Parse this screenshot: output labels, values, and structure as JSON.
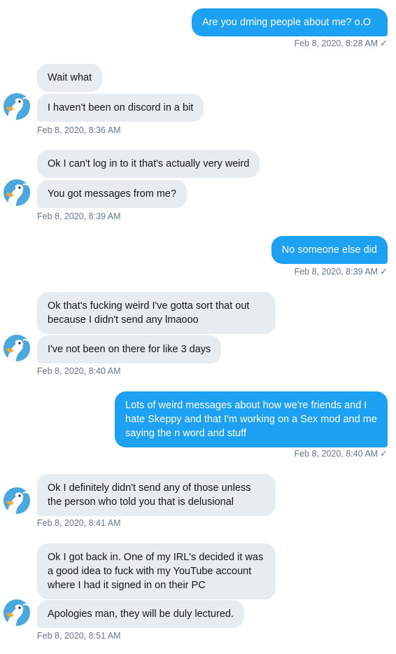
{
  "messages": [
    {
      "text": "Are you dming people about me? o.O"
    },
    {
      "text": "Wait what"
    },
    {
      "text": "I haven't been on discord in a bit"
    },
    {
      "text": "Ok I can't log in to it that's actually very weird"
    },
    {
      "text": "You got messages from me?"
    },
    {
      "text": "No someone else did"
    },
    {
      "text": "Ok that's fucking weird I've gotta sort that out because I didn't send any lmaooo"
    },
    {
      "text": "I've not been on there for like 3 days"
    },
    {
      "text": "Lots of weird messages about how we're friends and I hate Skeppy and that I'm working on a Sex mod and me saying the n word and stuff"
    },
    {
      "text": "Ok I definitely didn't send any of those unless the person who told you that is delusional"
    },
    {
      "text": "Ok I got back in.  One of my IRL's decided it was a good idea to fuck with my YouTube account where I had it signed in on their PC"
    },
    {
      "text": "Apologies man, they will be duly lectured."
    }
  ],
  "timestamps": [
    {
      "text": "Feb 8, 2020, 8:28 AM",
      "read_icon": "checkmark-icon"
    },
    {
      "text": "Feb 8, 2020, 8:36 AM"
    },
    {
      "text": "Feb 8, 2020, 8:39 AM"
    },
    {
      "text": "Feb 8, 2020, 8:39 AM",
      "read_icon": "checkmark-icon"
    },
    {
      "text": "Feb 8, 2020, 8:40 AM"
    },
    {
      "text": "Feb 8, 2020, 8:40 AM",
      "read_icon": "checkmark-icon"
    },
    {
      "text": "Feb 8, 2020, 8:41 AM"
    },
    {
      "text": "Feb 8, 2020, 8:51 AM"
    }
  ],
  "check_glyph": "✓",
  "colors": {
    "outgoing_bubble": "#1da1f2",
    "incoming_bubble": "#e6ecf0",
    "timestamp": "#657786",
    "avatar_bg": "#49a9e0"
  },
  "avatar_icon": "duck-avatar-icon"
}
